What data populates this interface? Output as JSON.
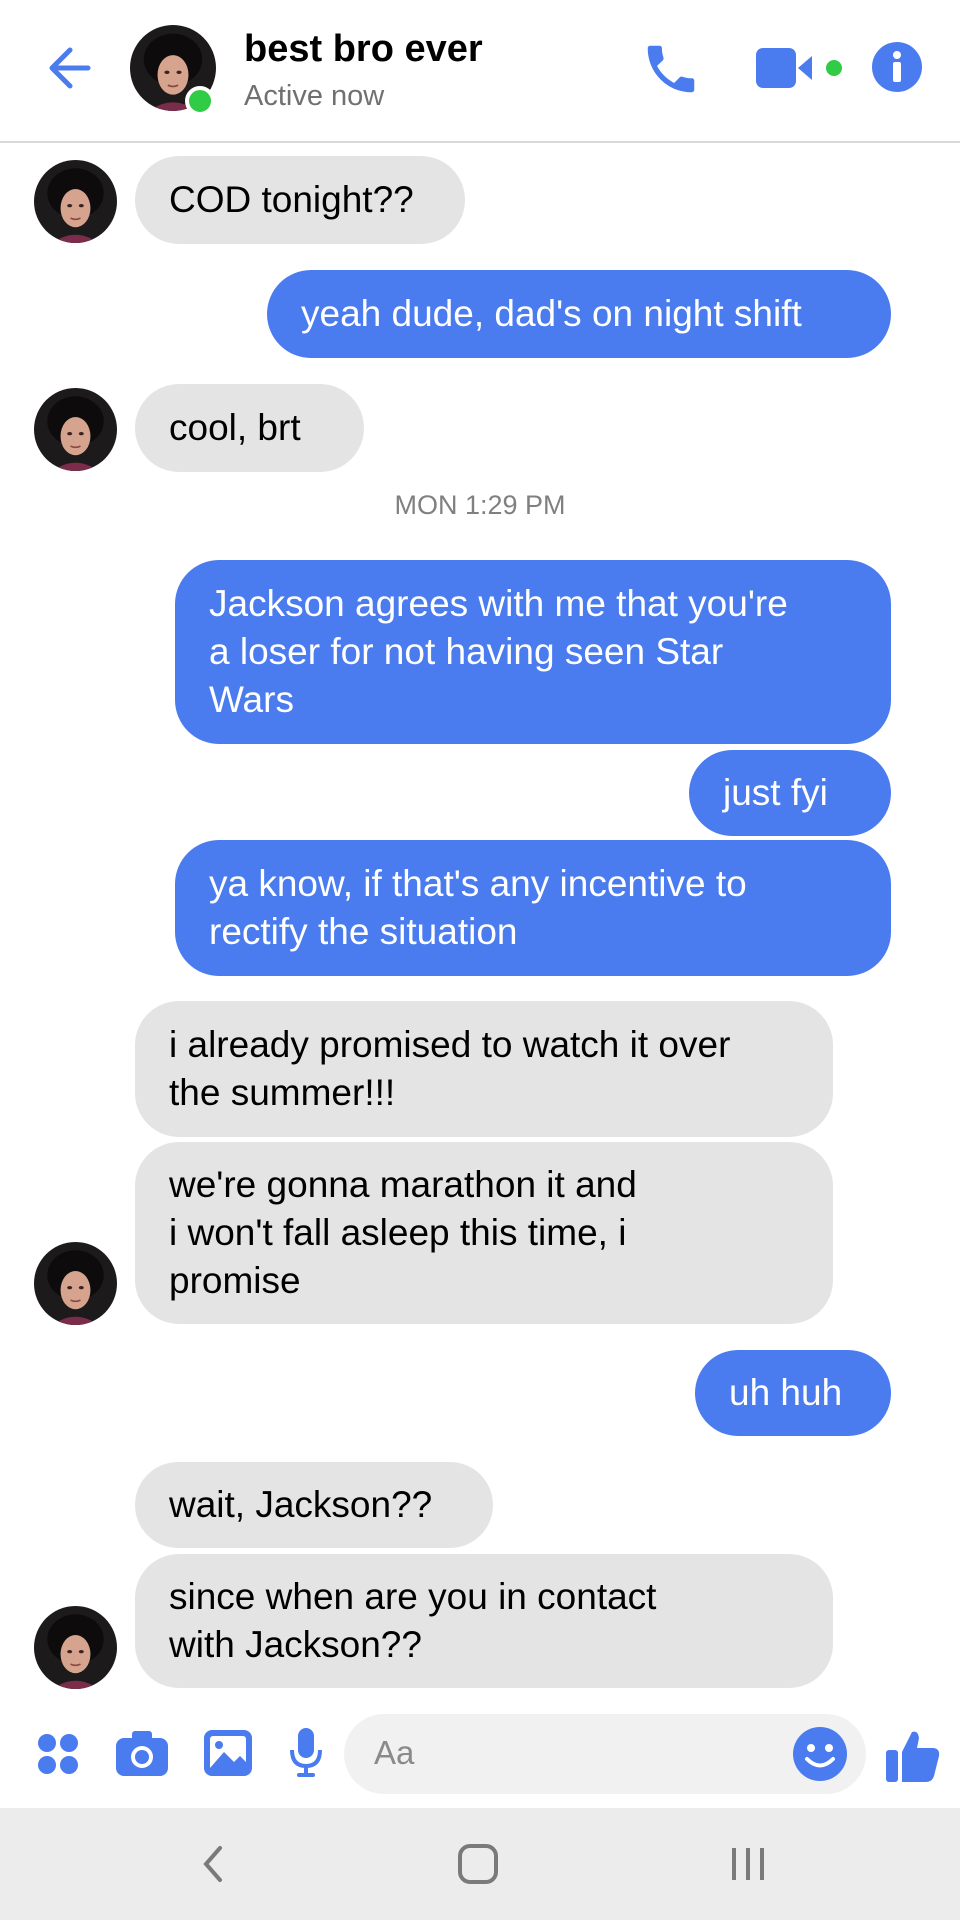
{
  "header": {
    "contact_name": "best bro ever",
    "status": "Active now"
  },
  "colors": {
    "accent": "#4a7cf0",
    "incoming_bubble": "#e4e4e4",
    "online": "#31cc46"
  },
  "icons": {
    "back": "arrow-left-icon",
    "call": "phone-icon",
    "video": "video-camera-icon",
    "info": "info-icon",
    "apps": "four-dots-icon",
    "camera": "camera-icon",
    "gallery": "image-icon",
    "mic": "microphone-icon",
    "emoji": "smiley-icon",
    "like": "thumbs-up-icon"
  },
  "messages": [
    {
      "from": "them",
      "text": "COD tonight??"
    },
    {
      "from": "me",
      "text": "yeah dude, dad's on night shift"
    },
    {
      "from": "them",
      "text": "cool, brt"
    },
    {
      "from": "me",
      "lines": [
        "Jackson agrees with me that you're",
        "a loser for not having seen Star",
        "Wars"
      ]
    },
    {
      "from": "me",
      "text": "just fyi"
    },
    {
      "from": "me",
      "lines": [
        "ya know, if that's any incentive to",
        "rectify the situation"
      ]
    },
    {
      "from": "them",
      "lines": [
        "i already promised to watch it over",
        "the summer!!!"
      ]
    },
    {
      "from": "them",
      "lines": [
        "we're gonna marathon it and",
        "i won't fall asleep this time, i",
        "promise"
      ]
    },
    {
      "from": "me",
      "text": "uh huh"
    },
    {
      "from": "them",
      "text": "wait, Jackson??"
    },
    {
      "from": "them",
      "lines": [
        "since when are you in contact",
        "with Jackson??"
      ]
    }
  ],
  "timestamp": "MON 1:29 PM",
  "composer": {
    "placeholder": "Aa"
  }
}
